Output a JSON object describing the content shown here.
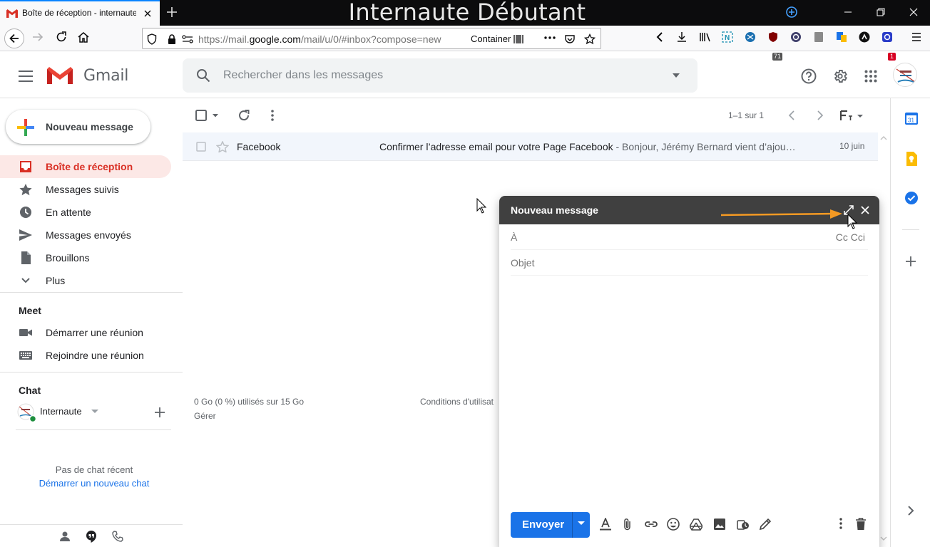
{
  "browser": {
    "tab_title": "Boîte de réception - internaute.debutant@gmail.com - Gmail",
    "window_title": "Internaute Débutant",
    "url_prefix": "https://mail.",
    "url_domain": "google.com",
    "url_rest": "/mail/u/0/#inbox?compose=new",
    "container_label": "Container",
    "ublock_count": "71",
    "ext_badge": "1"
  },
  "gmail": {
    "logo_text": "Gmail",
    "search_placeholder": "Rechercher dans les messages"
  },
  "sidebar": {
    "compose_label": "Nouveau message",
    "items": [
      {
        "label": "Boîte de réception",
        "icon": "inbox-icon",
        "active": true
      },
      {
        "label": "Messages suivis",
        "icon": "star-icon"
      },
      {
        "label": "En attente",
        "icon": "clock-icon"
      },
      {
        "label": "Messages envoyés",
        "icon": "send-icon"
      },
      {
        "label": "Brouillons",
        "icon": "draft-icon"
      },
      {
        "label": "Plus",
        "icon": "chevron-down-icon"
      }
    ],
    "meet_title": "Meet",
    "meet_items": [
      {
        "label": "Démarrer une réunion",
        "icon": "video-icon"
      },
      {
        "label": "Rejoindre une réunion",
        "icon": "keyboard-icon"
      }
    ],
    "chat_title": "Chat",
    "chat_user": "Internaute",
    "no_chat": "Pas de chat récent",
    "new_chat": "Démarrer un nouveau chat"
  },
  "list": {
    "pagination": "1–1 sur 1",
    "rows": [
      {
        "sender": "Facebook",
        "subject": "Confirmer l’adresse email pour votre Page Facebook",
        "snippet": " - Bonjour, Jérémy Bernard vient d’ajou…",
        "date": "10 juin"
      }
    ],
    "storage": "0 Go (0 %) utilisés sur 15 Go",
    "manage": "Gérer",
    "terms": "Conditions d'utilisat"
  },
  "compose": {
    "title": "Nouveau message",
    "to_label": "À",
    "cc_label": "Cc Cci",
    "subject_placeholder": "Objet",
    "send_label": "Envoyer"
  },
  "calendar_day": "31",
  "colors": {
    "accent": "#1a73e8",
    "gmail_red": "#d93025",
    "compose_header": "#404040",
    "annotation_arrow": "#f59a23"
  }
}
